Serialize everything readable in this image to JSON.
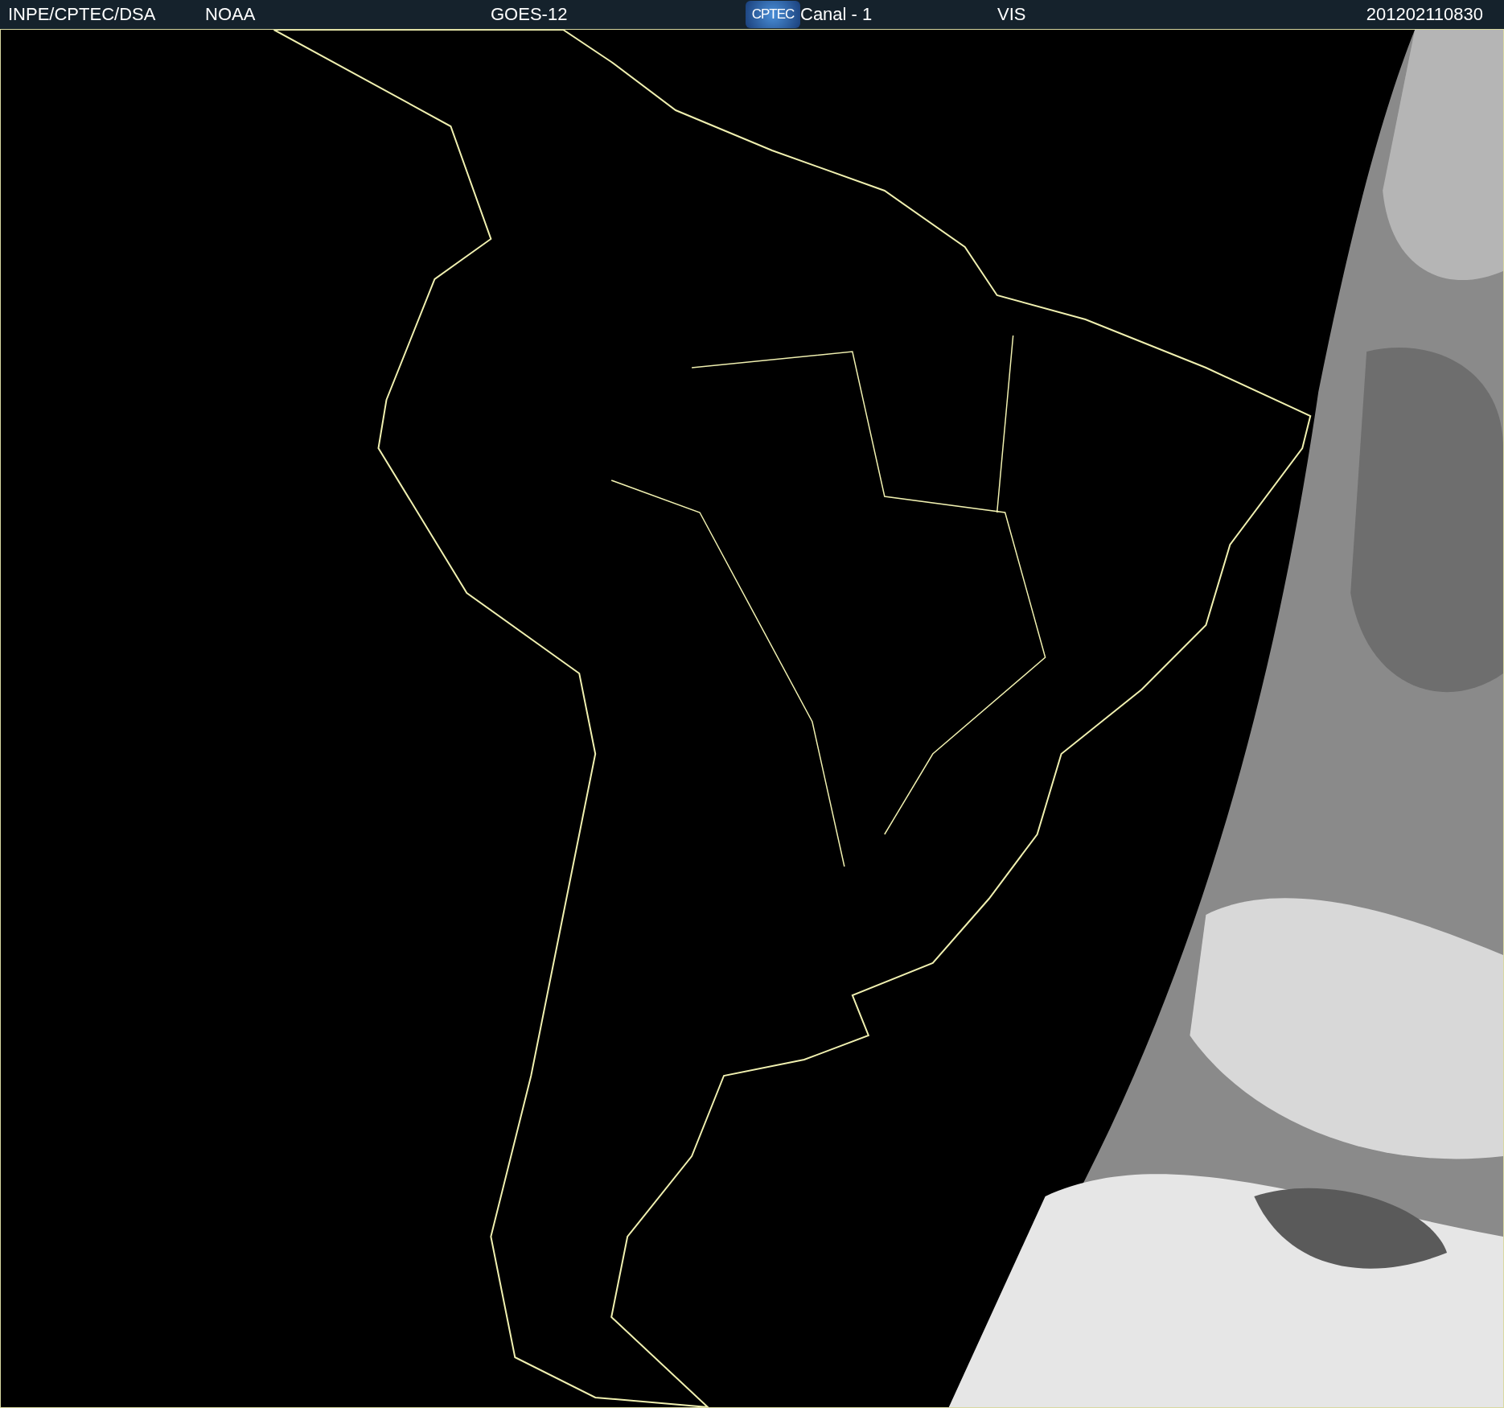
{
  "header": {
    "items": [
      {
        "kind": "text",
        "text": "INPE/CPTEC/DSA"
      },
      {
        "kind": "text",
        "text": "NOAA"
      },
      {
        "kind": "text",
        "text": "GOES-12"
      },
      {
        "kind": "logo",
        "text": "CPTEC"
      },
      {
        "kind": "text",
        "text": "Canal - 1"
      },
      {
        "kind": "text",
        "text": "VIS"
      },
      {
        "kind": "text",
        "text": "201202110830"
      }
    ]
  }
}
